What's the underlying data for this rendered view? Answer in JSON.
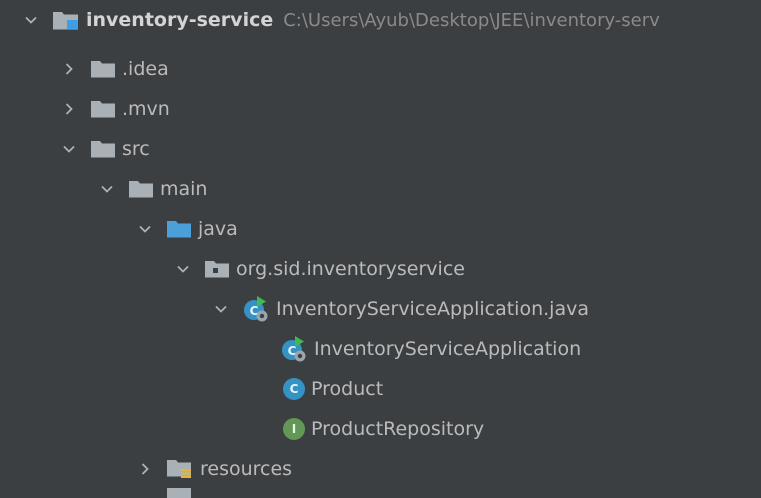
{
  "colors": {
    "background": "#3c3f41",
    "text": "#bbbbbb",
    "folder": "#a9b0b6",
    "source_folder": "#4ca0d9",
    "class_icon": "#3592c4",
    "interface_icon": "#629755",
    "run_arrow": "#3fb950",
    "resources_badge": "#e2b63f"
  },
  "tree": {
    "root": {
      "name": "inventory-service",
      "path": "C:\\Users\\Ayub\\Desktop\\JEE\\inventory-serv",
      "icon": "module-folder-icon"
    },
    "idea": {
      "name": ".idea",
      "icon": "folder-icon"
    },
    "mvn": {
      "name": ".mvn",
      "icon": "folder-icon"
    },
    "src": {
      "name": "src",
      "icon": "folder-icon"
    },
    "main": {
      "name": "main",
      "icon": "folder-icon"
    },
    "java": {
      "name": "java",
      "icon": "source-folder-icon"
    },
    "package": {
      "name": "org.sid.inventoryservice",
      "icon": "package-icon"
    },
    "file": {
      "name": "InventoryServiceApplication.java",
      "icon": "spring-boot-class-icon"
    },
    "app_class": {
      "name": "InventoryServiceApplication",
      "icon": "spring-boot-class-icon"
    },
    "product": {
      "name": "Product",
      "icon": "class-icon",
      "badge": "C"
    },
    "repository": {
      "name": "ProductRepository",
      "icon": "interface-icon",
      "badge": "I"
    },
    "resources": {
      "name": "resources",
      "icon": "resources-folder-icon"
    }
  }
}
